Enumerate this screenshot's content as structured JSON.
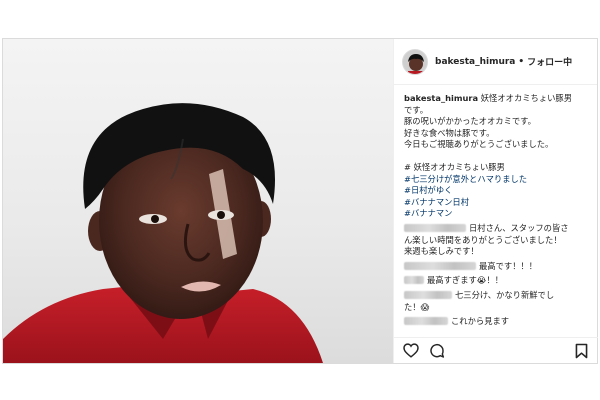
{
  "post": {
    "username": "bakesta_himura",
    "separator": "•",
    "follow_status": "フォロー中",
    "caption": {
      "username": "bakesta_himura",
      "first_line": "妖怪オオカミちょい豚男",
      "lines": [
        "です。",
        "豚の呪いがかかったオオカミです。",
        "好きな食べ物は豚です。",
        "今日もご視聴ありがとうございました。"
      ],
      "hashtags": [
        "# 妖怪オオカミちょい豚男",
        "#七三分けが意外とハマりました",
        "#日村がゆく",
        "#バナナマン日村",
        "#バナナマン"
      ]
    },
    "comments": [
      {
        "lines": [
          "日村さん、スタッフの皆さ",
          "ん楽しい時間をありがとうございました！",
          "来週も楽しみです！"
        ]
      },
      {
        "lines": [
          "最高です！！！"
        ]
      },
      {
        "lines": [
          "最高すぎます😭！！"
        ]
      },
      {
        "lines": [
          "七三分け、かなり新鮮でし",
          "た！😱"
        ]
      },
      {
        "lines": [
          "これから見ます"
        ]
      }
    ],
    "icons": {
      "like": "heart-icon",
      "comment": "comment-icon",
      "save": "bookmark-icon"
    }
  }
}
